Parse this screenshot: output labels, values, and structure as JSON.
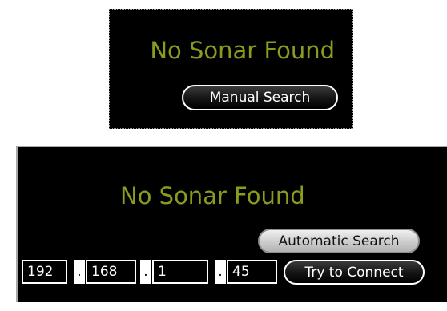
{
  "panel_manual": {
    "status": "No Sonar Found",
    "manual_search_label": "Manual Search"
  },
  "panel_auto": {
    "status": "No Sonar Found",
    "automatic_search_label": "Automatic Search",
    "ip_octets": [
      "192",
      "168",
      "1",
      "45"
    ],
    "ip_separator": ".",
    "connect_label": "Try to Connect"
  },
  "colors": {
    "background": "#000000",
    "status_text": "#8c9a1e",
    "button_text_dark": "#ffffff",
    "button_text_light": "#111111"
  }
}
